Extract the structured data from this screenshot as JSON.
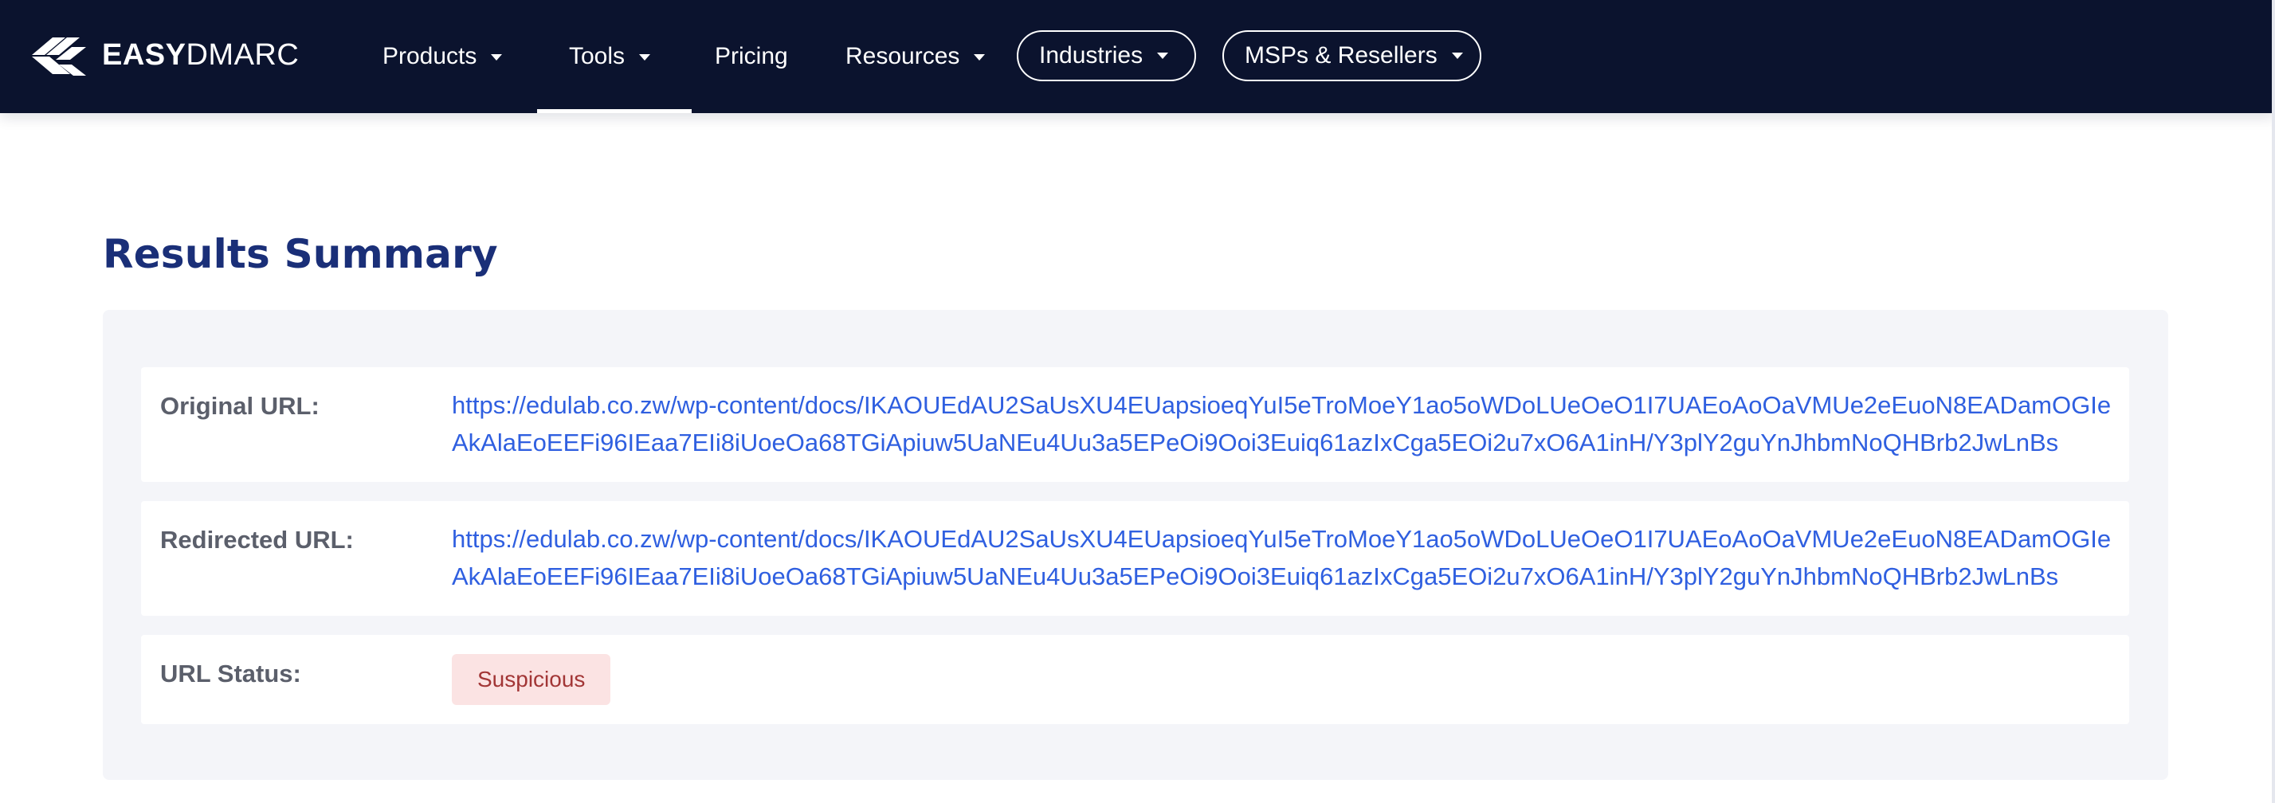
{
  "brand": {
    "name_bold": "EASY",
    "name_light": "DMARC"
  },
  "nav": {
    "items": [
      {
        "label": "Products",
        "has_dropdown": true
      },
      {
        "label": "Tools",
        "has_dropdown": true,
        "active": true
      },
      {
        "label": "Pricing",
        "has_dropdown": false
      },
      {
        "label": "Resources",
        "has_dropdown": true
      }
    ],
    "pills": [
      {
        "label": "Industries",
        "has_dropdown": true
      },
      {
        "label": "MSPs & Resellers",
        "has_dropdown": true
      }
    ]
  },
  "icons": {
    "logo": "easydmarc-logo-icon",
    "caret": "caret-down-icon"
  },
  "results": {
    "title": "Results Summary",
    "rows": [
      {
        "label": "Original URL:",
        "value": "https://edulab.co.zw/wp-content/docs/IKAOUEdAU2SaUsXU4EUapsioeqYuI5eTroMoeY1ao5oWDoLUeOeO1I7UAEoAoOaVMUe2eEuoN8EADamOGIeAkAlaEoEEFi96IEaa7EIi8iUoeOa68TGiApiuw5UaNEu4Uu3a5EPeOi9Ooi3Euiq61azIxCga5EOi2u7xO6A1inH/Y3plY2guYnJhbmNoQHBrb2JwLnBs"
      },
      {
        "label": "Redirected URL:",
        "value": "https://edulab.co.zw/wp-content/docs/IKAOUEdAU2SaUsXU4EUapsioeqYuI5eTroMoeY1ao5oWDoLUeOeO1I7UAEoAoOaVMUe2eEuoN8EADamOGIeAkAlaEoEEFi96IEaa7EIi8iUoeOa68TGiApiuw5UaNEu4Uu3a5EPeOi9Ooi3Euiq61azIxCga5EOi2u7xO6A1inH/Y3plY2guYnJhbmNoQHBrb2JwLnBs"
      },
      {
        "label": "URL Status:",
        "status": "Suspicious"
      }
    ]
  },
  "colors": {
    "nav_background": "#0b132e",
    "title": "#1a2f78",
    "link": "#2f5fe0",
    "status_badge_bg": "#fbe3e3",
    "status_badge_text": "#a23636",
    "panel_background": "#f4f5f9"
  }
}
